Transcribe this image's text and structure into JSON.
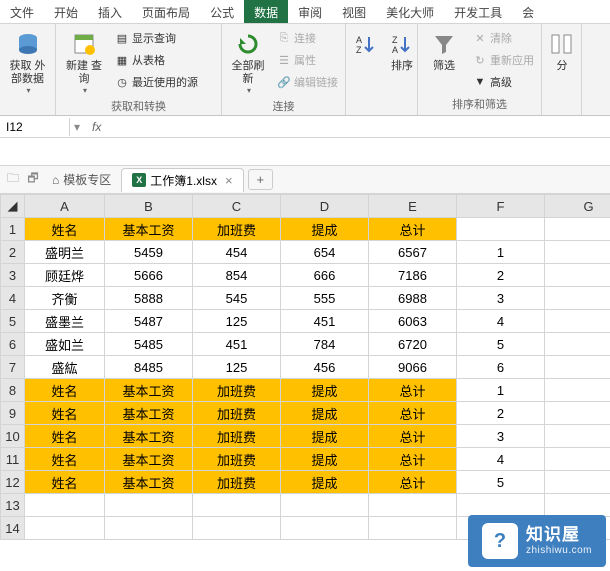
{
  "tabs": [
    "文件",
    "开始",
    "插入",
    "页面布局",
    "公式",
    "数据",
    "审阅",
    "视图",
    "美化大师",
    "开发工具",
    "会"
  ],
  "active_tab_index": 5,
  "ribbon": {
    "group_labels": [
      "",
      "获取和转换",
      "连接",
      "",
      "排序和筛选",
      ""
    ],
    "get_external": {
      "label": "获取\n外部数据"
    },
    "new_query": {
      "label": "新建\n查询"
    },
    "show_query": "显示查询",
    "from_table": "从表格",
    "recent_sources": "最近使用的源",
    "refresh_all": {
      "label": "全部刷新"
    },
    "connections": "连接",
    "properties": "属性",
    "edit_links": "编辑链接",
    "sort": {
      "label": "排序"
    },
    "filter": {
      "label": "筛选"
    },
    "clear": "清除",
    "reapply": "重新应用",
    "advanced": "高级",
    "split": {
      "label": "分"
    }
  },
  "name_box": "I12",
  "formula": "",
  "wb_tabs": {
    "template_zone": "模板专区",
    "file_name": "工作簿1.xlsx"
  },
  "grid": {
    "col_headers": [
      "A",
      "B",
      "C",
      "D",
      "E",
      "F",
      "G"
    ],
    "row_headers": [
      1,
      2,
      3,
      4,
      5,
      6,
      7,
      8,
      9,
      10,
      11,
      12,
      13,
      14
    ],
    "header_row": [
      "姓名",
      "基本工资",
      "加班费",
      "提成",
      "总计"
    ],
    "data_rows": [
      {
        "name": "盛明兰",
        "base": 5459,
        "ot": 454,
        "bonus": 654,
        "total": 6567,
        "num": 1
      },
      {
        "name": "顾廷烨",
        "base": 5666,
        "ot": 854,
        "bonus": 666,
        "total": 7186,
        "num": 2
      },
      {
        "name": "齐衡",
        "base": 5888,
        "ot": 545,
        "bonus": 555,
        "total": 6988,
        "num": 3
      },
      {
        "name": "盛墨兰",
        "base": 5487,
        "ot": 125,
        "bonus": 451,
        "total": 6063,
        "num": 4
      },
      {
        "name": "盛如兰",
        "base": 5485,
        "ot": 451,
        "bonus": 784,
        "total": 6720,
        "num": 5
      },
      {
        "name": "盛紘",
        "base": 8485,
        "ot": 125,
        "bonus": 456,
        "total": 9066,
        "num": 6
      }
    ],
    "repeat_header_nums": [
      1,
      2,
      3,
      4,
      5
    ]
  },
  "watermark": {
    "title": "知识屋",
    "sub": "zhishiwu.com"
  }
}
